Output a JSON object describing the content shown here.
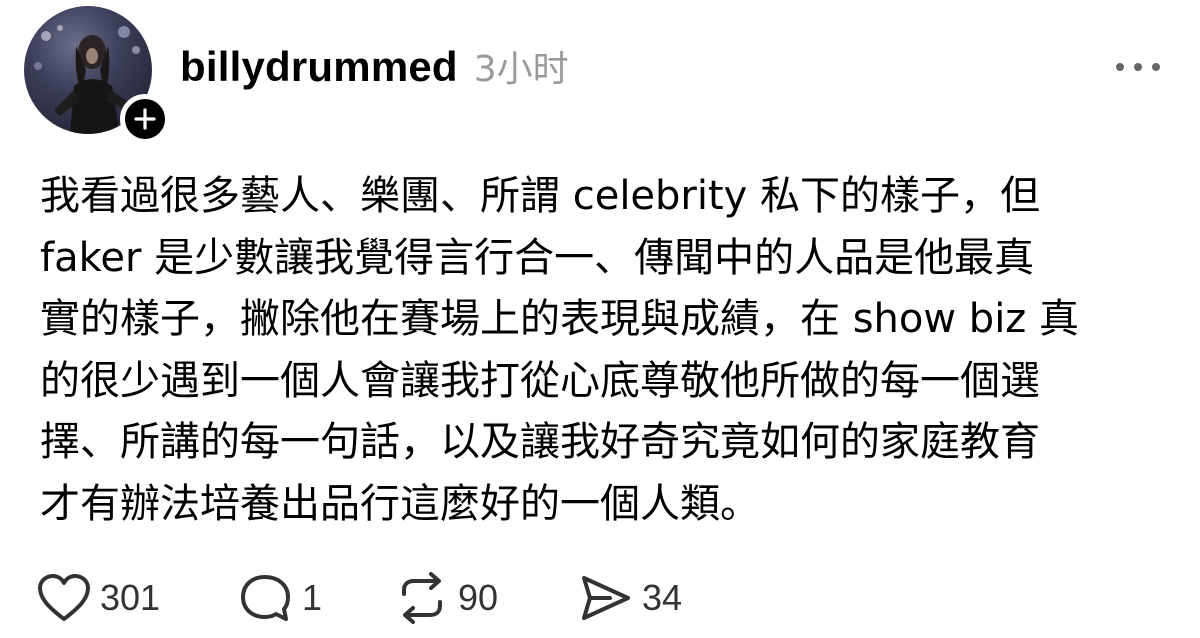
{
  "post": {
    "author": {
      "username": "billydrummed",
      "avatar_icon": "profile-photo",
      "follow_icon": "plus-icon"
    },
    "timestamp": "3小时",
    "more_icon": "ellipsis-icon",
    "body_lines": [
      "我看過很多藝人、樂團、所謂 celebrity 私下的樣子，但",
      "faker 是少數讓我覺得言行合一、傳聞中的人品是他最真",
      "實的樣子，撇除他在賽場上的表現與成績，在 show biz 真",
      "的很少遇到一個人會讓我打從心底尊敬他所做的每一個選",
      "擇、所講的每一句話，以及讓我好奇究竟如何的家庭教育",
      "才有辦法培養出品行這麼好的一個人類。"
    ],
    "actions": {
      "like": {
        "icon": "heart-icon",
        "count": "301"
      },
      "reply": {
        "icon": "comment-icon",
        "count": "1"
      },
      "repost": {
        "icon": "repost-icon",
        "count": "90"
      },
      "share": {
        "icon": "send-icon",
        "count": "34"
      }
    }
  },
  "colors": {
    "text": "#000000",
    "muted": "#9a9a9a",
    "count": "#333333",
    "badge": "#000000",
    "background": "#ffffff"
  }
}
